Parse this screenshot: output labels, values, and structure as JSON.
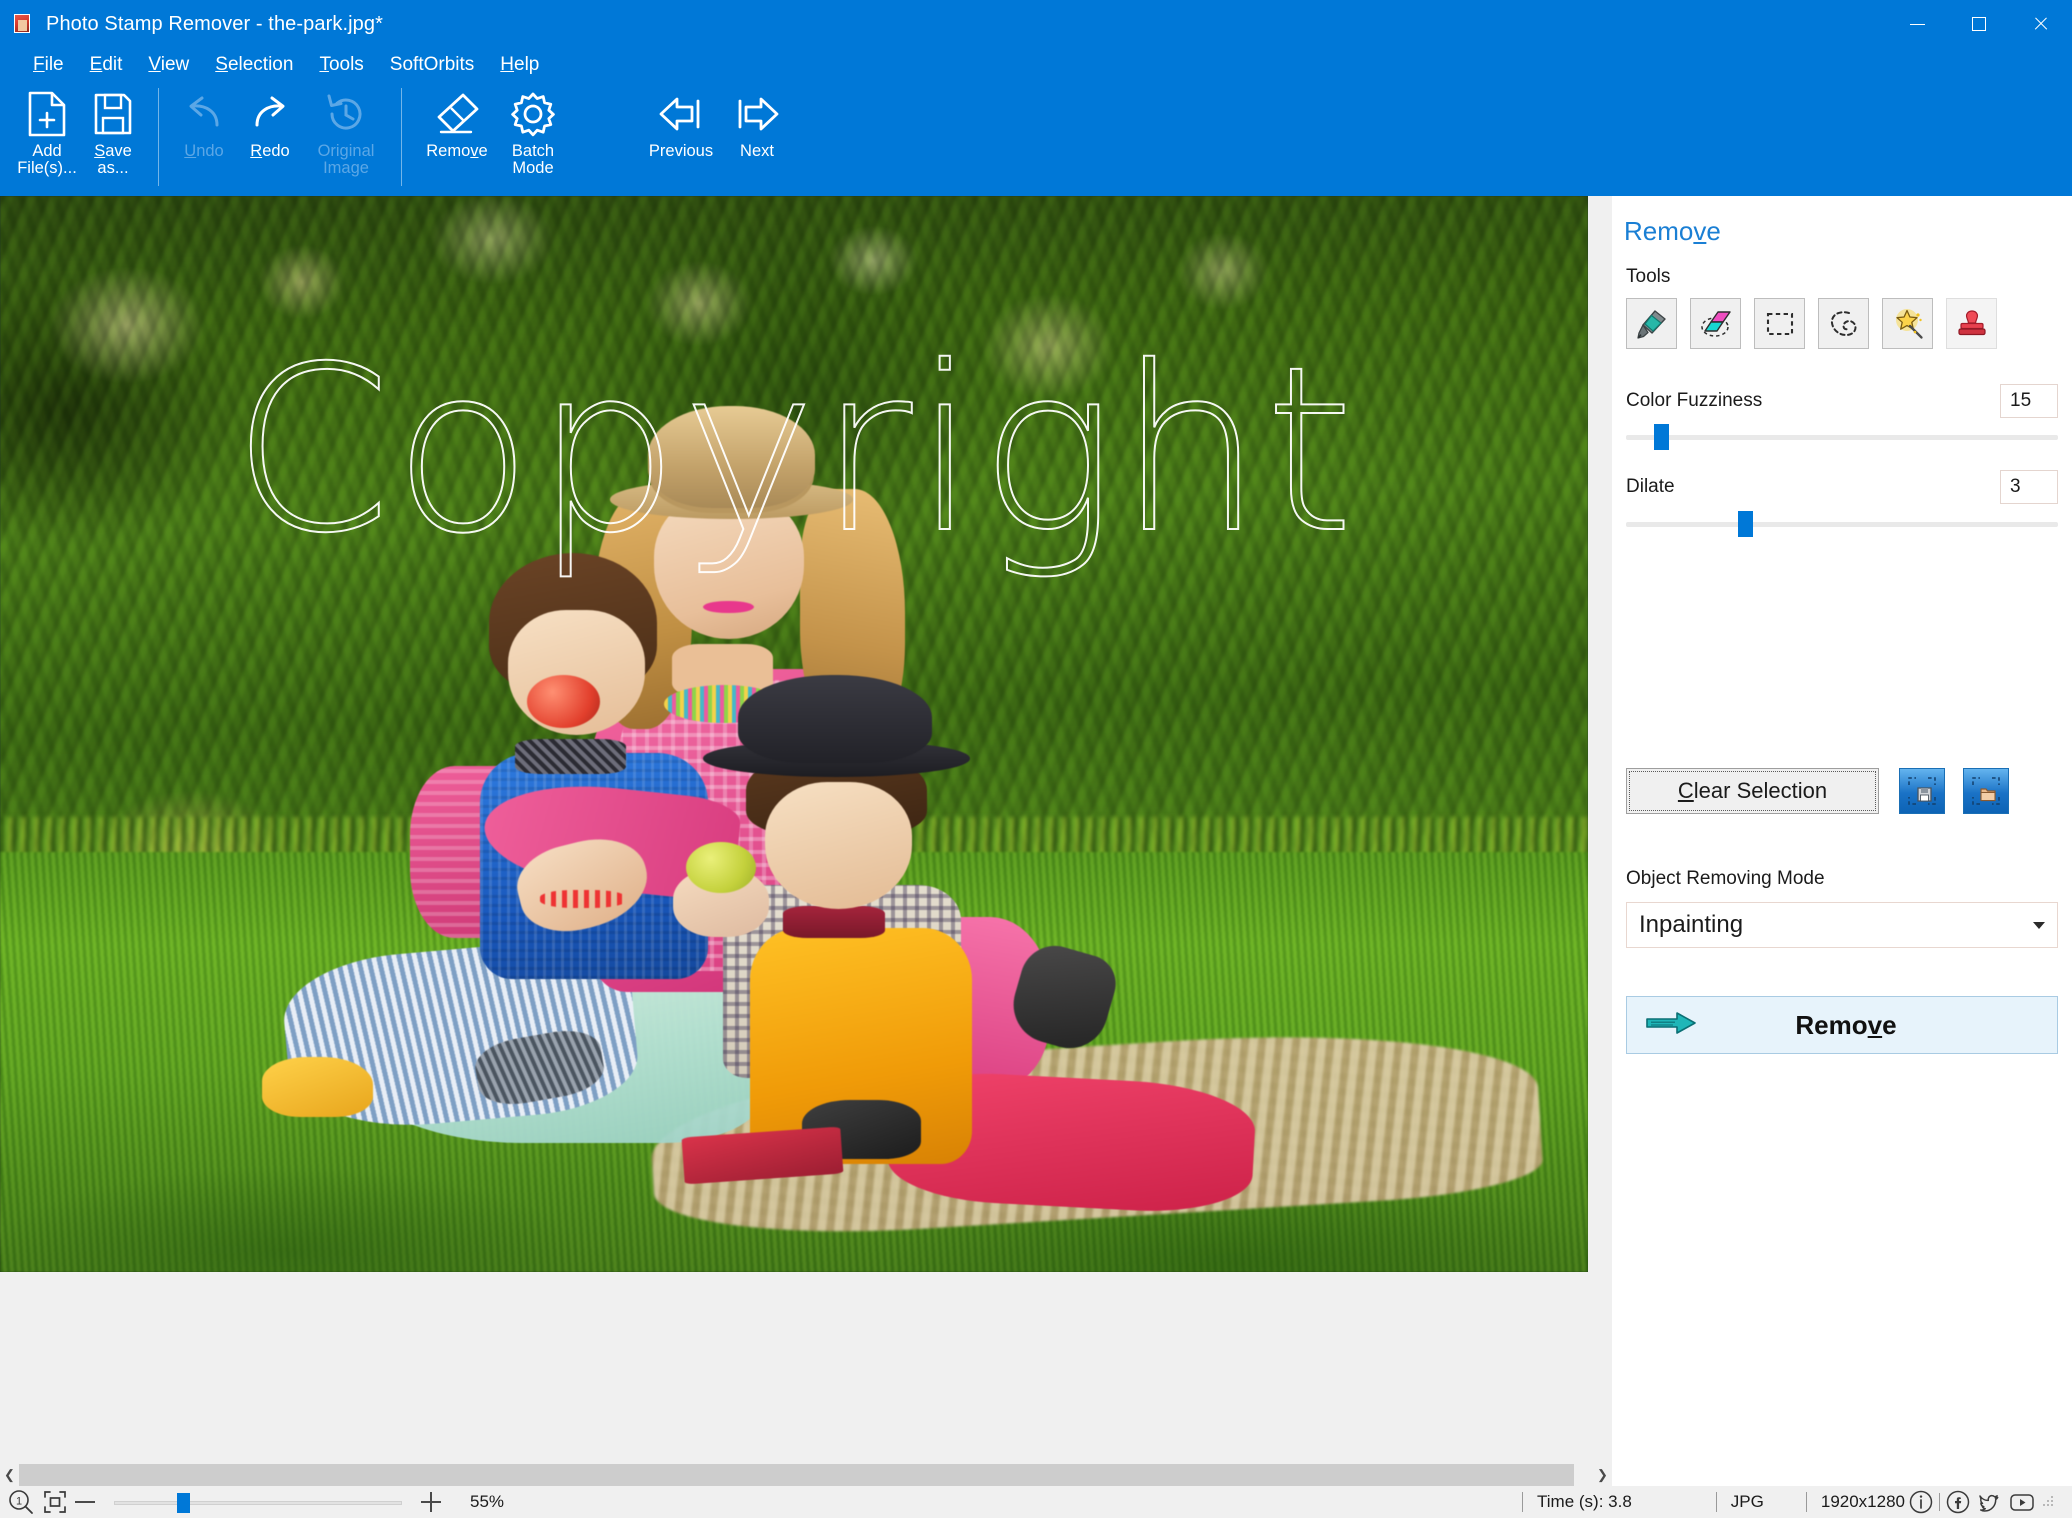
{
  "window": {
    "app_name": "Photo Stamp Remover",
    "title": "Photo Stamp Remover - the-park.jpg*",
    "minimize_label": "Minimize",
    "maximize_label": "Maximize",
    "close_label": "Close",
    "accent_color": "#0078d7"
  },
  "menubar": {
    "items": [
      {
        "label": "File",
        "mnemonic": "F"
      },
      {
        "label": "Edit",
        "mnemonic": "E"
      },
      {
        "label": "View",
        "mnemonic": "V"
      },
      {
        "label": "Selection",
        "mnemonic": "S"
      },
      {
        "label": "Tools",
        "mnemonic": "T"
      },
      {
        "label": "SoftOrbits",
        "mnemonic": ""
      },
      {
        "label": "Help",
        "mnemonic": "H"
      }
    ]
  },
  "toolbar": {
    "buttons": [
      {
        "label": "Add\nFile(s)...",
        "icon": "add-file-icon",
        "enabled": true
      },
      {
        "label": "Save\nas...",
        "icon": "save-icon",
        "enabled": true
      },
      {
        "label": "Undo",
        "icon": "undo-icon",
        "enabled": false
      },
      {
        "label": "Redo",
        "icon": "redo-icon",
        "enabled": true
      },
      {
        "label": "Original\nImage",
        "icon": "original-image-icon",
        "enabled": false
      },
      {
        "label": "Remove",
        "icon": "eraser-icon",
        "enabled": true
      },
      {
        "label": "Batch\nMode",
        "icon": "gear-icon",
        "enabled": true
      },
      {
        "label": "Previous",
        "icon": "arrow-left-icon",
        "enabled": true
      },
      {
        "label": "Next",
        "icon": "arrow-right-icon",
        "enabled": true
      }
    ]
  },
  "canvas": {
    "watermark_text": "Copyright",
    "image_alt": "Mother in straw hat sitting on grass with two boys on a picnic blanket in a park"
  },
  "panel": {
    "title": "Remove",
    "title_mnemonic": "v",
    "tools_label": "Tools",
    "tools": [
      {
        "name": "marker-tool",
        "title": "Marker"
      },
      {
        "name": "eraser-tool",
        "title": "Eraser",
        "selected": true
      },
      {
        "name": "rectangle-select-tool",
        "title": "Rectangle Select"
      },
      {
        "name": "lasso-tool",
        "title": "Lasso"
      },
      {
        "name": "magic-wand-tool",
        "title": "Magic Wand"
      },
      {
        "name": "stamp-tool",
        "title": "Stamp"
      }
    ],
    "color_fuzziness": {
      "label": "Color Fuzziness",
      "value": "15",
      "percent": 8
    },
    "dilate": {
      "label": "Dilate",
      "value": "3",
      "percent": 22
    },
    "clear_selection_label": "Clear Selection",
    "clear_selection_mnemonic": "C",
    "save_selection_title": "Save Selection",
    "load_selection_title": "Load Selection",
    "object_removing_mode_label": "Object Removing Mode",
    "object_removing_mode_value": "Inpainting",
    "remove_button_label": "Remove",
    "remove_button_mnemonic": "v"
  },
  "statusbar": {
    "zoom_level": "55%",
    "zoom_actual_title": "Actual Size",
    "zoom_fit_title": "Fit to Window",
    "zoom_out_title": "Zoom Out",
    "zoom_in_title": "Zoom In",
    "time_label": "Time (s): 3.8",
    "format_label": "JPG",
    "dimensions_label": "1920x1280",
    "social": [
      {
        "name": "info-icon",
        "title": "Info"
      },
      {
        "name": "facebook-icon",
        "title": "Facebook"
      },
      {
        "name": "twitter-icon",
        "title": "Twitter"
      },
      {
        "name": "youtube-icon",
        "title": "YouTube"
      }
    ]
  }
}
